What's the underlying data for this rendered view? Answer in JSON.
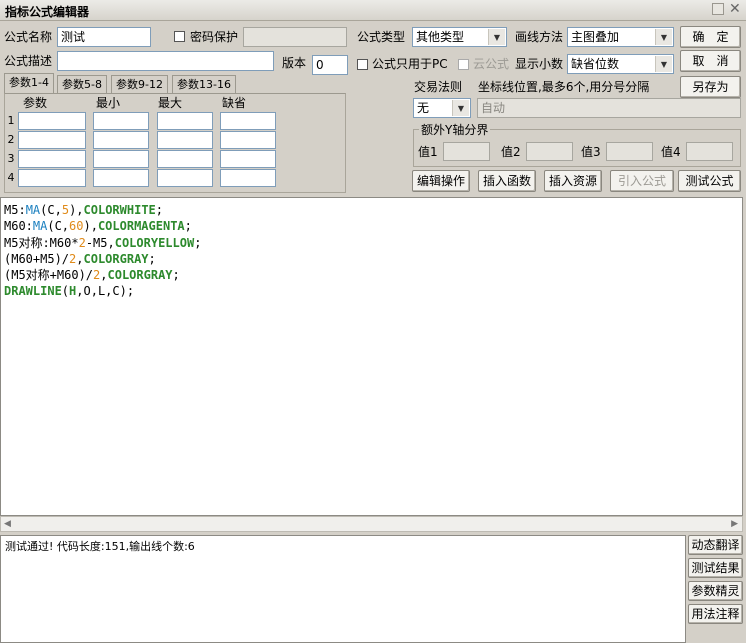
{
  "window": {
    "title": "指标公式编辑器"
  },
  "form": {
    "name_label": "公式名称",
    "name_value": "测试",
    "password_label": "密码保护",
    "desc_label": "公式描述",
    "version_label": "版本",
    "version_value": "0",
    "type_label": "公式类型",
    "type_value": "其他类型",
    "draw_label": "画线方法",
    "draw_value": "主图叠加",
    "pc_only_label": "公式只用于PC",
    "cloud_label": "云公式",
    "decimals_label": "显示小数",
    "decimals_value": "缺省位数"
  },
  "buttons": {
    "ok": "确　定",
    "cancel": "取　消",
    "save_as": "另存为"
  },
  "params": {
    "tabs": [
      "参数1-4",
      "参数5-8",
      "参数9-12",
      "参数13-16"
    ],
    "headers": [
      "参数",
      "最小",
      "最大",
      "缺省"
    ],
    "rows": [
      "1",
      "2",
      "3",
      "4"
    ]
  },
  "trade": {
    "label": "交易法则",
    "value": "无",
    "coord_label": "坐标线位置,最多6个,用分号分隔",
    "coord_value": "自动"
  },
  "yaxis": {
    "title": "额外Y轴分界",
    "labels": [
      "值1",
      "值2",
      "值3",
      "值4"
    ]
  },
  "actions": [
    "编辑操作",
    "插入函数",
    "插入资源",
    "引入公式",
    "测试公式"
  ],
  "code_lines": [
    [
      [
        "M5:",
        ""
      ],
      [
        "MA",
        "k"
      ],
      [
        "(C,",
        ""
      ],
      [
        "5",
        "n"
      ],
      [
        "),",
        ""
      ],
      [
        "COLORWHITE",
        "g"
      ],
      [
        ";",
        ""
      ]
    ],
    [
      [
        "M60:",
        ""
      ],
      [
        "MA",
        "k"
      ],
      [
        "(C,",
        ""
      ],
      [
        "60",
        "n"
      ],
      [
        "),",
        ""
      ],
      [
        "COLORMAGENTA",
        "g"
      ],
      [
        ";",
        ""
      ]
    ],
    [
      [
        "M5对称:M60*",
        ""
      ],
      [
        "2",
        "n"
      ],
      [
        "-M5,",
        ""
      ],
      [
        "COLORYELLOW",
        "g"
      ],
      [
        ";",
        ""
      ]
    ],
    [
      [
        "(M60+M5)/",
        ""
      ],
      [
        "2",
        "n"
      ],
      [
        ",",
        ""
      ],
      [
        "COLORGRAY",
        "g"
      ],
      [
        ";",
        ""
      ]
    ],
    [
      [
        "(M5对称+M60)/",
        ""
      ],
      [
        "2",
        "n"
      ],
      [
        ",",
        ""
      ],
      [
        "COLORGRAY",
        "g"
      ],
      [
        ";",
        ""
      ]
    ],
    [
      [
        "DRAWLINE",
        "g"
      ],
      [
        "(",
        ""
      ],
      [
        "H",
        "g"
      ],
      [
        ",O,L,C);",
        ""
      ]
    ]
  ],
  "output": {
    "text": "测试通过! 代码长度:151,输出线个数:6"
  },
  "side_buttons": [
    "动态翻译",
    "测试结果",
    "参数精灵",
    "用法注释"
  ]
}
